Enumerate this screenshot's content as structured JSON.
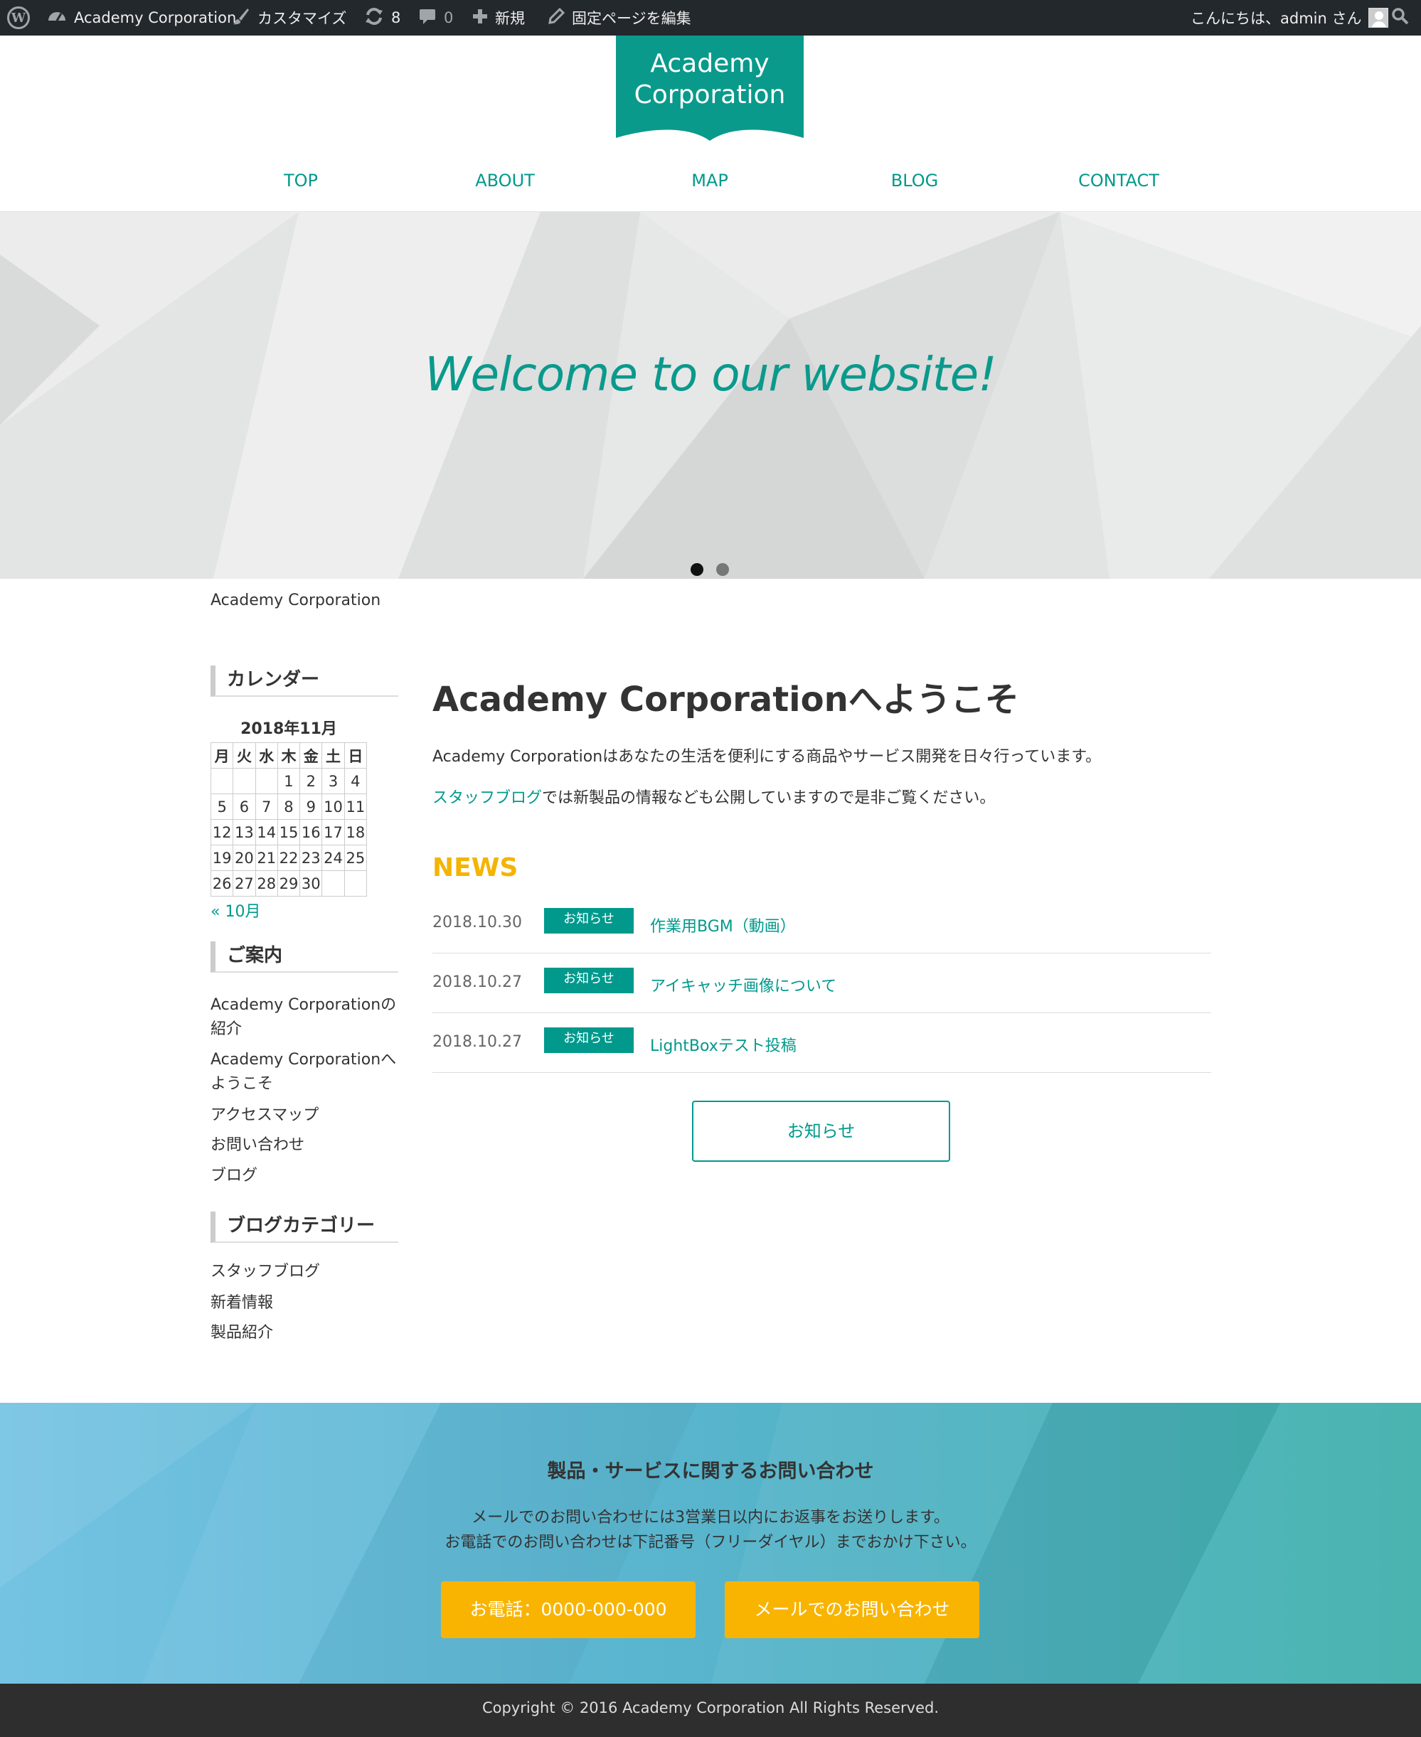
{
  "adminbar": {
    "site_name": "Academy Corporation",
    "customize": "カスタマイズ",
    "updates_count": "8",
    "comments_count": "0",
    "new": "新規",
    "edit_page": "固定ページを編集",
    "greeting": "こんにちは、admin さん"
  },
  "header": {
    "logo_line1": "Academy",
    "logo_line2": "Corporation",
    "nav": [
      "TOP",
      "ABOUT",
      "MAP",
      "BLOG",
      "CONTACT"
    ]
  },
  "hero": {
    "text": "Welcome to our website!",
    "slides": 2,
    "active_slide": 1
  },
  "breadcrumb": "Academy Corporation",
  "sidebar": {
    "calendar_title": "カレンダー",
    "calendar_caption": "2018年11月",
    "weekdays": [
      "月",
      "火",
      "水",
      "木",
      "金",
      "土",
      "日"
    ],
    "weeks": [
      [
        "",
        "",
        "",
        "1",
        "2",
        "3",
        "4"
      ],
      [
        "5",
        "6",
        "7",
        "8",
        "9",
        "10",
        "11"
      ],
      [
        "12",
        "13",
        "14",
        "15",
        "16",
        "17",
        "18"
      ],
      [
        "19",
        "20",
        "21",
        "22",
        "23",
        "24",
        "25"
      ],
      [
        "26",
        "27",
        "28",
        "29",
        "30",
        "",
        ""
      ]
    ],
    "calendar_prev": "« 10月",
    "guide_title": "ご案内",
    "guide_links": [
      "Academy Corporationの紹介",
      "Academy Corporationへようこそ",
      "アクセスマップ",
      "お問い合わせ",
      "ブログ"
    ],
    "category_title": "ブログカテゴリー",
    "category_links": [
      "スタッフブログ",
      "新着情報",
      "製品紹介"
    ]
  },
  "main": {
    "title": "Academy Corporationへようこそ",
    "para1": "Academy Corporationはあなたの生活を便利にする商品やサービス開発を日々行っています。",
    "para2_link": "スタッフブログ",
    "para2_rest": "では新製品の情報なども公開していますので是非ご覧ください。",
    "news_heading": "NEWS",
    "news": [
      {
        "date": "2018.10.30",
        "badge": "お知らせ",
        "title": "作業用BGM（動画）"
      },
      {
        "date": "2018.10.27",
        "badge": "お知らせ",
        "title": "アイキャッチ画像について"
      },
      {
        "date": "2018.10.27",
        "badge": "お知らせ",
        "title": "LightBoxテスト投稿"
      }
    ],
    "news_button": "お知らせ"
  },
  "cta": {
    "title": "製品・サービスに関するお問い合わせ",
    "line1": "メールでのお問い合わせには3営業日以内にお返事をお送りします。",
    "line2": "お電話でのお問い合わせは下記番号（フリーダイヤル）までおかけ下さい。",
    "phone_button": "お電話：0000-000-000",
    "mail_button": "メールでのお問い合わせ"
  },
  "footer": {
    "copyright": "Copyright © 2016 Academy Corporation All Rights Reserved."
  },
  "colors": {
    "accent": "#00998c",
    "news_heading": "#f4b400",
    "cta_button": "#f8b400",
    "adminbar": "#23282d",
    "footer": "#2e2e2e"
  }
}
